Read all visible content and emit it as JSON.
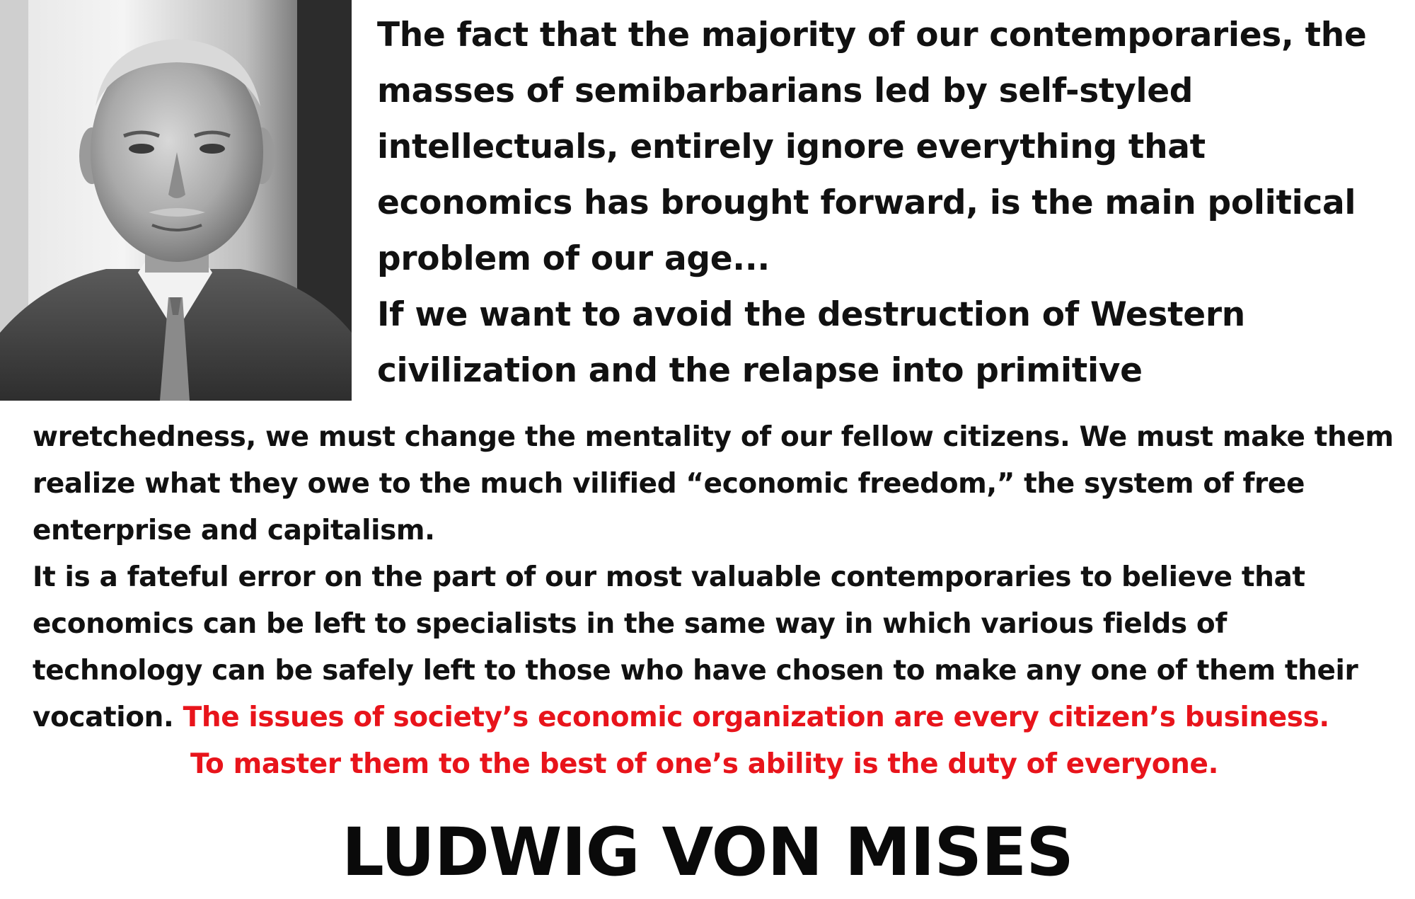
{
  "portrait": {
    "icon": "portrait-photo",
    "tone": "grayscale"
  },
  "quote": {
    "top_paragraphs": [
      "The fact that the majority of our contemporaries, the masses of semibarbarians led by self-styled intellectuals, entirely ignore everything that economics has brought forward, is the main political problem of our age...",
      "If we want to avoid the destruction of Western civilization and the relapse into primitive"
    ],
    "body_paragraphs": [
      "wretchedness, we must change the mentality of our fellow citizens. We must make them realize what they owe to the much vilified “economic freedom,” the system of free enterprise and capitalism.",
      "It is a fateful error on the part of our most valuable contemporaries to believe that economics can be left to specialists in the same way in which various fields of technology can be safely left to those who have chosen to make any one of them their vocation."
    ],
    "highlight_lines": [
      "The issues of society’s economic organization are every citizen’s business.",
      "To master them to the best of one’s ability is the duty of everyone."
    ]
  },
  "author": "LUDWIG VON MISES",
  "colors": {
    "highlight": "#e8141b",
    "text": "#111111",
    "background": "#ffffff"
  }
}
